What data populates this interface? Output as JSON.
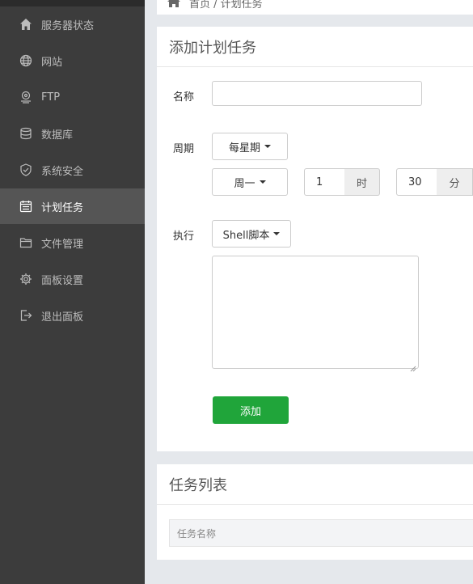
{
  "sidebar": {
    "items": [
      {
        "label": "服务器状态",
        "icon": "home-icon"
      },
      {
        "label": "网站",
        "icon": "globe-icon"
      },
      {
        "label": "FTP",
        "icon": "ftp-icon"
      },
      {
        "label": "数据库",
        "icon": "database-icon"
      },
      {
        "label": "系统安全",
        "icon": "shield-icon"
      },
      {
        "label": "计划任务",
        "icon": "calendar-icon",
        "active": true
      },
      {
        "label": "文件管理",
        "icon": "folder-icon"
      },
      {
        "label": "面板设置",
        "icon": "gear-icon"
      },
      {
        "label": "退出面板",
        "icon": "logout-icon"
      }
    ]
  },
  "breadcrumb": {
    "text": "首页 / 计划任务"
  },
  "add_task": {
    "title": "添加计划任务",
    "name_label": "名称",
    "name_value": "",
    "cycle_label": "周期",
    "cycle_select": "每星期",
    "weekday_select": "周一",
    "hour_value": "1",
    "hour_unit": "时",
    "minute_value": "30",
    "minute_unit": "分",
    "exec_label": "执行",
    "exec_type": "Shell脚本",
    "script_value": "",
    "add_button": "添加"
  },
  "task_list": {
    "title": "任务列表",
    "columns": [
      "任务名称"
    ]
  },
  "colors": {
    "sidebar_bg": "#3c3c3c",
    "sidebar_active": "#555555",
    "accent_green": "#20a53a",
    "page_bg": "#e5e8ec"
  }
}
